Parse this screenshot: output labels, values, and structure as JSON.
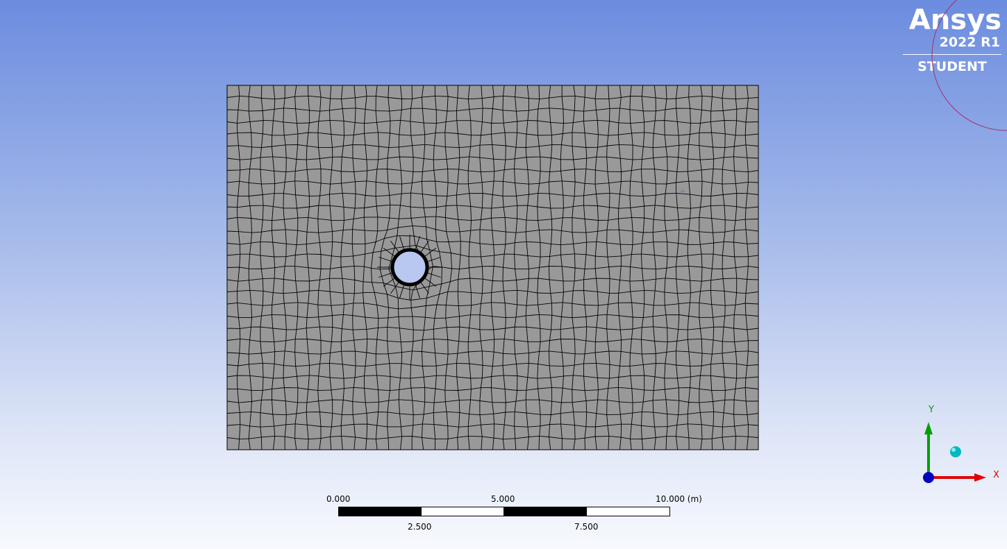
{
  "logo": {
    "brand": "Ansys",
    "version": "2022 R1",
    "edition": "STUDENT"
  },
  "mesh": {
    "fill_color": "#999999",
    "line_color": "#000000",
    "hole_color": "#b8c8f0",
    "columns": 46,
    "rows": 30
  },
  "scale_bar": {
    "label_0": "0.000",
    "label_5": "5.000",
    "label_10": "10.000 (m)",
    "label_2_5": "2.500",
    "label_7_5": "7.500"
  },
  "triad": {
    "x_label": "X",
    "y_label": "Y",
    "x_color": "#e00000",
    "y_color": "#00a000",
    "z_color": "#0000c0",
    "iso_color": "#00c0c0"
  },
  "colors": {
    "background_top": "#6b8cdf",
    "background_bottom": "#f7f9fe",
    "logo": "#ffffff"
  }
}
